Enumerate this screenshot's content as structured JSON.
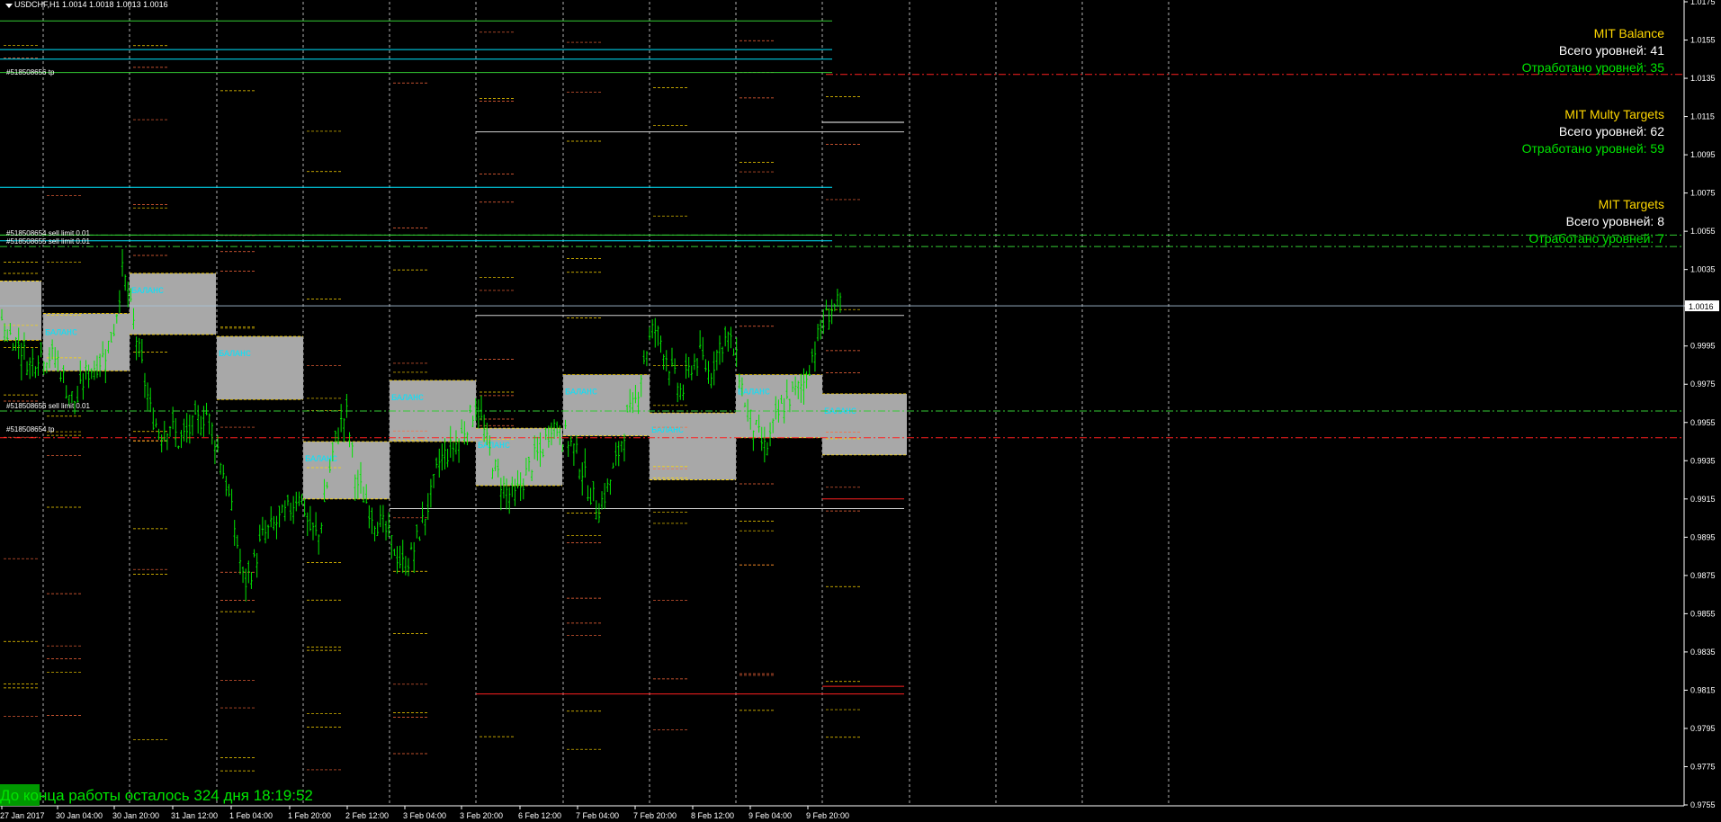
{
  "chart": {
    "title": "USDCHF,H1  1.0014 1.0018 1.0013 1.0016",
    "current_price_label": "1.0016"
  },
  "panels": [
    {
      "title": "MIT Balance",
      "total": "Всего уровней: 41",
      "done": "Отработано уровней: 35"
    },
    {
      "title": "MIT Multy Targets",
      "total": "Всего уровней: 62",
      "done": "Отработано уровней: 59"
    },
    {
      "title": "MIT Targets",
      "total": "Всего уровней: 8",
      "done": "Отработано уровней: 7"
    }
  ],
  "countdown": "До конца работы осталось 324 дня 18:19:52",
  "orders": [
    "#518508656 tp",
    "#518508654 sell limit 0.01",
    "#518508655 sell limit 0.01",
    "#518508656 sell limit 0.01",
    "#518508654 tp"
  ],
  "balance_label": "БАЛАНС",
  "colors": {
    "candles": "#00e600",
    "grid": "#ffffff",
    "level_orange": "#ff6a3d",
    "level_yellow": "#ffd700",
    "cyan": "#00e5ff",
    "green_line": "#33cc33",
    "red": "#ff2020",
    "balance_box": "#a8a8a8",
    "panel_title": "#ffd700",
    "panel_done": "#00e600"
  },
  "chart_data": {
    "type": "candlestick",
    "symbol": "USDCHF",
    "timeframe": "H1",
    "ohlc_current": {
      "open": 1.0014,
      "high": 1.0018,
      "low": 1.0013,
      "close": 1.0016
    },
    "ylim": [
      0.9755,
      1.0175
    ],
    "price_ticks": [
      "1.0175",
      "1.0155",
      "1.0135",
      "1.0115",
      "1.0095",
      "1.0075",
      "1.0055",
      "1.0035",
      "1.0016",
      "0.9995",
      "0.9975",
      "0.9955",
      "0.9935",
      "0.9915",
      "0.9895",
      "0.9875",
      "0.9855",
      "0.9835",
      "0.9815",
      "0.9795",
      "0.9775",
      "0.9755"
    ],
    "time_ticks": [
      "27 Jan 2017",
      "30 Jan 04:00",
      "30 Jan 20:00",
      "31 Jan 12:00",
      "1 Feb 04:00",
      "1 Feb 20:00",
      "2 Feb 12:00",
      "3 Feb 04:00",
      "3 Feb 20:00",
      "6 Feb 12:00",
      "7 Feb 04:00",
      "7 Feb 20:00",
      "8 Feb 12:00",
      "9 Feb 04:00",
      "9 Feb 20:00"
    ],
    "close_path": [
      1.0005,
      1.0,
      0.9995,
      0.9985,
      0.9992,
      0.999,
      0.9988,
      0.9972,
      0.9965,
      0.998,
      0.9985,
      0.999,
      1.0003,
      1.0035,
      1.001,
      0.9985,
      0.996,
      0.995,
      0.9955,
      0.9945,
      0.995,
      0.9955,
      0.996,
      0.9945,
      0.9925,
      0.99,
      0.987,
      0.988,
      0.9895,
      0.99,
      0.9905,
      0.991,
      0.992,
      0.99,
      0.9895,
      0.9925,
      0.995,
      0.996,
      0.9925,
      0.9915,
      0.9905,
      0.99,
      0.989,
      0.988,
      0.9885,
      0.99,
      0.9915,
      0.9935,
      0.994,
      0.9945,
      0.9955,
      0.9965,
      0.9945,
      0.993,
      0.992,
      0.9915,
      0.9925,
      0.9935,
      0.994,
      0.9955,
      0.995,
      0.9945,
      0.9935,
      0.992,
      0.991,
      0.992,
      0.9935,
      0.9955,
      0.9965,
      0.999,
      1.0005,
      0.9995,
      0.998,
      0.997,
      0.9985,
      0.999,
      0.998,
      0.9995,
      1.0,
      0.9985,
      0.996,
      0.995,
      0.994,
      0.9955,
      0.9965,
      0.997,
      0.9975,
      0.999,
      1.0005,
      1.0015,
      1.0016
    ],
    "grid_on": true
  }
}
